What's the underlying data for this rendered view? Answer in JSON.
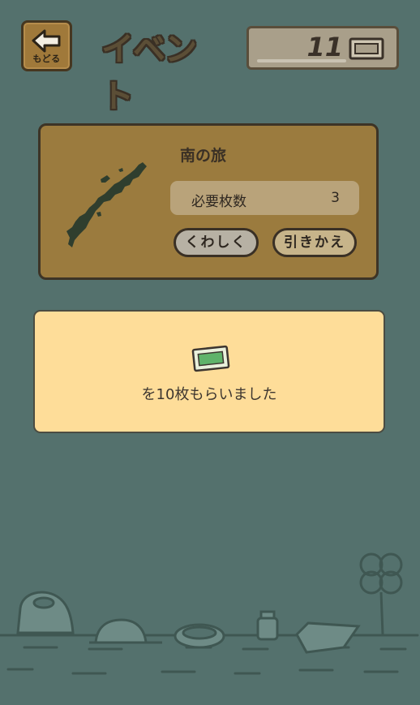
{
  "header": {
    "back_label": "もどる",
    "title": "イベント",
    "ticket_count": "11"
  },
  "event": {
    "name": "南の旅",
    "requirement_label": "必要枚数",
    "requirement_value": "3",
    "details_label": "くわしく",
    "exchange_label": "引きかえ"
  },
  "reward": {
    "message": "を10枚もらいました"
  },
  "colors": {
    "background": "#54716d",
    "card_brown": "#9b7b3e",
    "reward_bg": "#fedd99"
  }
}
